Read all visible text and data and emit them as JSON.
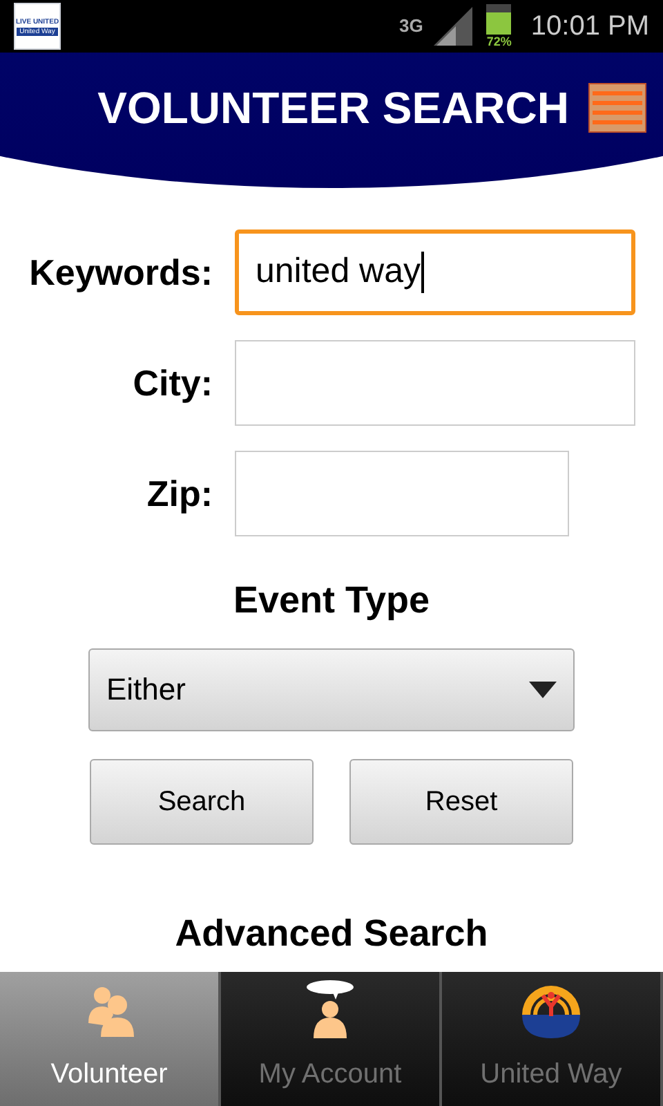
{
  "status_bar": {
    "app_logo": {
      "line_1": "LIVE UNITED",
      "line_2": "United Way"
    },
    "network": "3G",
    "battery": "72%",
    "time": "10:01 PM"
  },
  "header": {
    "title": "VOLUNTEER SEARCH"
  },
  "fields": [
    {
      "label": "Keywords:",
      "value": "united way",
      "focused": true
    },
    {
      "label": "City:",
      "focused": false
    },
    {
      "label": "Zip:",
      "focused": false
    }
  ],
  "event_type": {
    "heading": "Event Type",
    "value": "Either"
  },
  "buttons": [
    "Search",
    "Reset"
  ],
  "advanced_search": "Advanced Search",
  "tabs": [
    {
      "label": "Volunteer",
      "kind": "people",
      "selected": true
    },
    {
      "label": "My Account",
      "kind": "account",
      "selected": false
    },
    {
      "label": "United Way",
      "kind": "logo",
      "selected": false
    }
  ]
}
